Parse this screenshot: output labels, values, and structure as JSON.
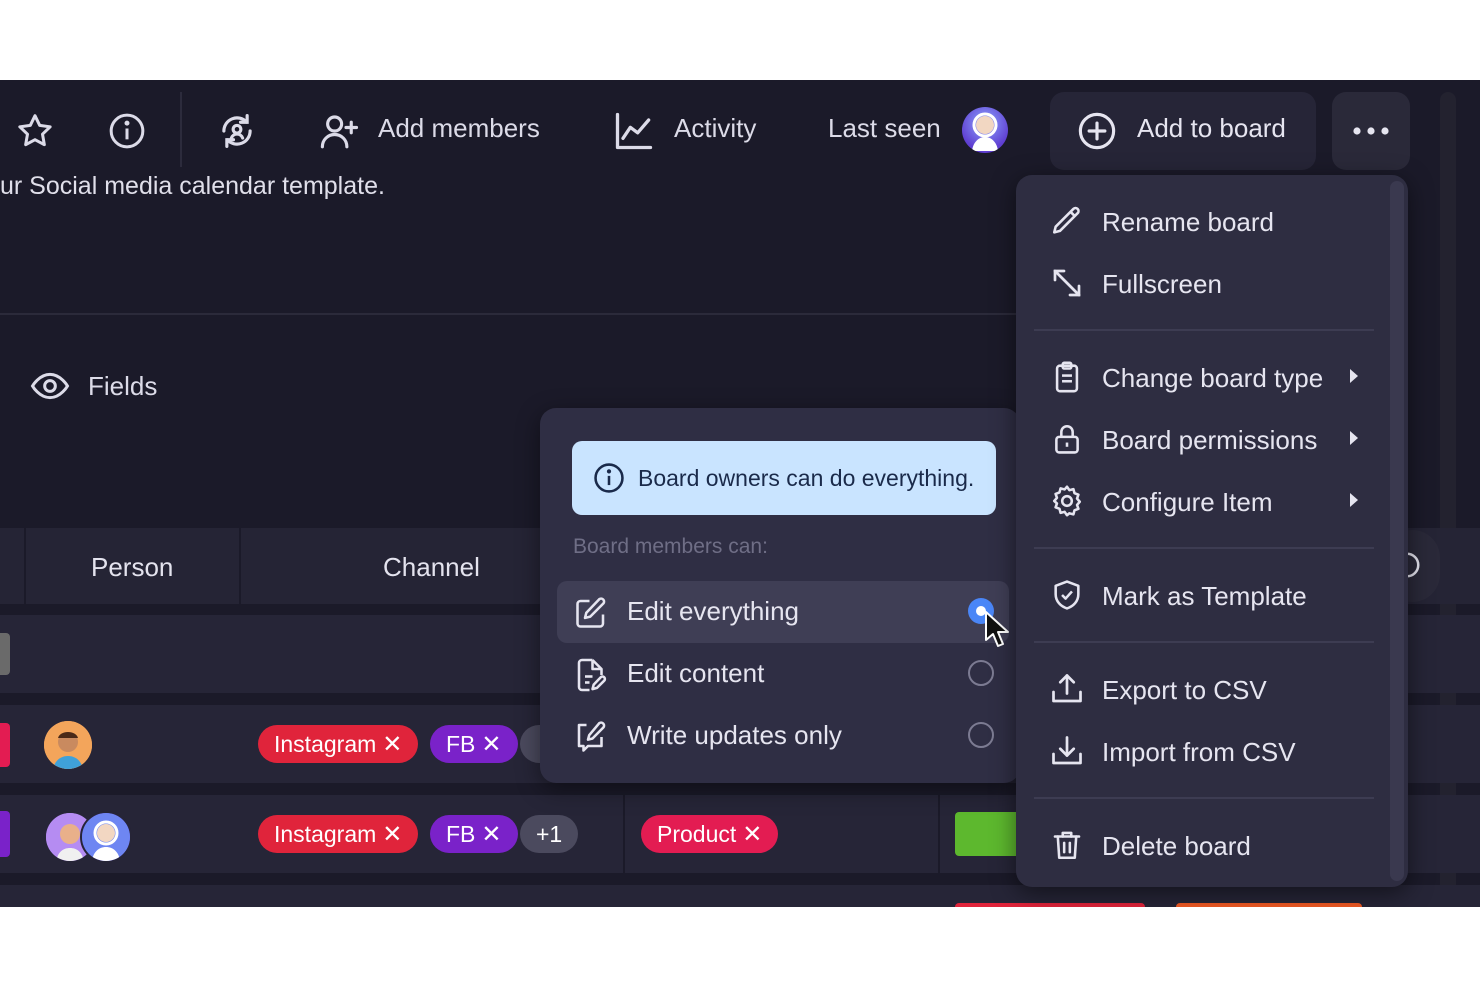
{
  "toolbar": {
    "add_members": "Add members",
    "activity": "Activity",
    "last_seen": "Last seen",
    "add_to_board": "Add to board"
  },
  "subtitle": "ur Social media calendar template.",
  "fields_label": "Fields",
  "table": {
    "headers": [
      "Person",
      "Channel"
    ],
    "rows": [
      {
        "channels": [
          "Instagram",
          "FB"
        ]
      },
      {
        "channels": [
          "Instagram",
          "FB"
        ],
        "more": "+1",
        "tag": "Product"
      }
    ]
  },
  "permissions_popover": {
    "info": "Board owners can do everything.",
    "members_label": "Board members can:",
    "options": [
      {
        "label": "Edit everything",
        "selected": true,
        "icon": "edit-square-icon"
      },
      {
        "label": "Edit content",
        "selected": false,
        "icon": "file-edit-icon"
      },
      {
        "label": "Write updates only",
        "selected": false,
        "icon": "comment-edit-icon"
      }
    ]
  },
  "board_menu": {
    "items": [
      {
        "label": "Rename board",
        "icon": "pencil-icon"
      },
      {
        "label": "Fullscreen",
        "icon": "expand-arrow-icon"
      },
      {
        "label": "Change board type",
        "icon": "clipboard-icon",
        "submenu": true
      },
      {
        "label": "Board permissions",
        "icon": "lock-icon",
        "submenu": true
      },
      {
        "label": "Configure Item",
        "icon": "gear-icon",
        "submenu": true
      },
      {
        "label": "Mark as Template",
        "icon": "shield-check-icon"
      },
      {
        "label": "Export to CSV",
        "icon": "upload-icon"
      },
      {
        "label": "Import from CSV",
        "icon": "download-icon"
      },
      {
        "label": "Delete board",
        "icon": "trash-icon"
      }
    ]
  },
  "colors": {
    "background": "#1b1a29",
    "menu": "#2e2d41",
    "info_box": "#c9e4ff",
    "radio_selected": "#4a86f7",
    "pill_instagram": "#e0243b",
    "pill_fb": "#7a22c9",
    "pill_product": "#e31c52"
  }
}
